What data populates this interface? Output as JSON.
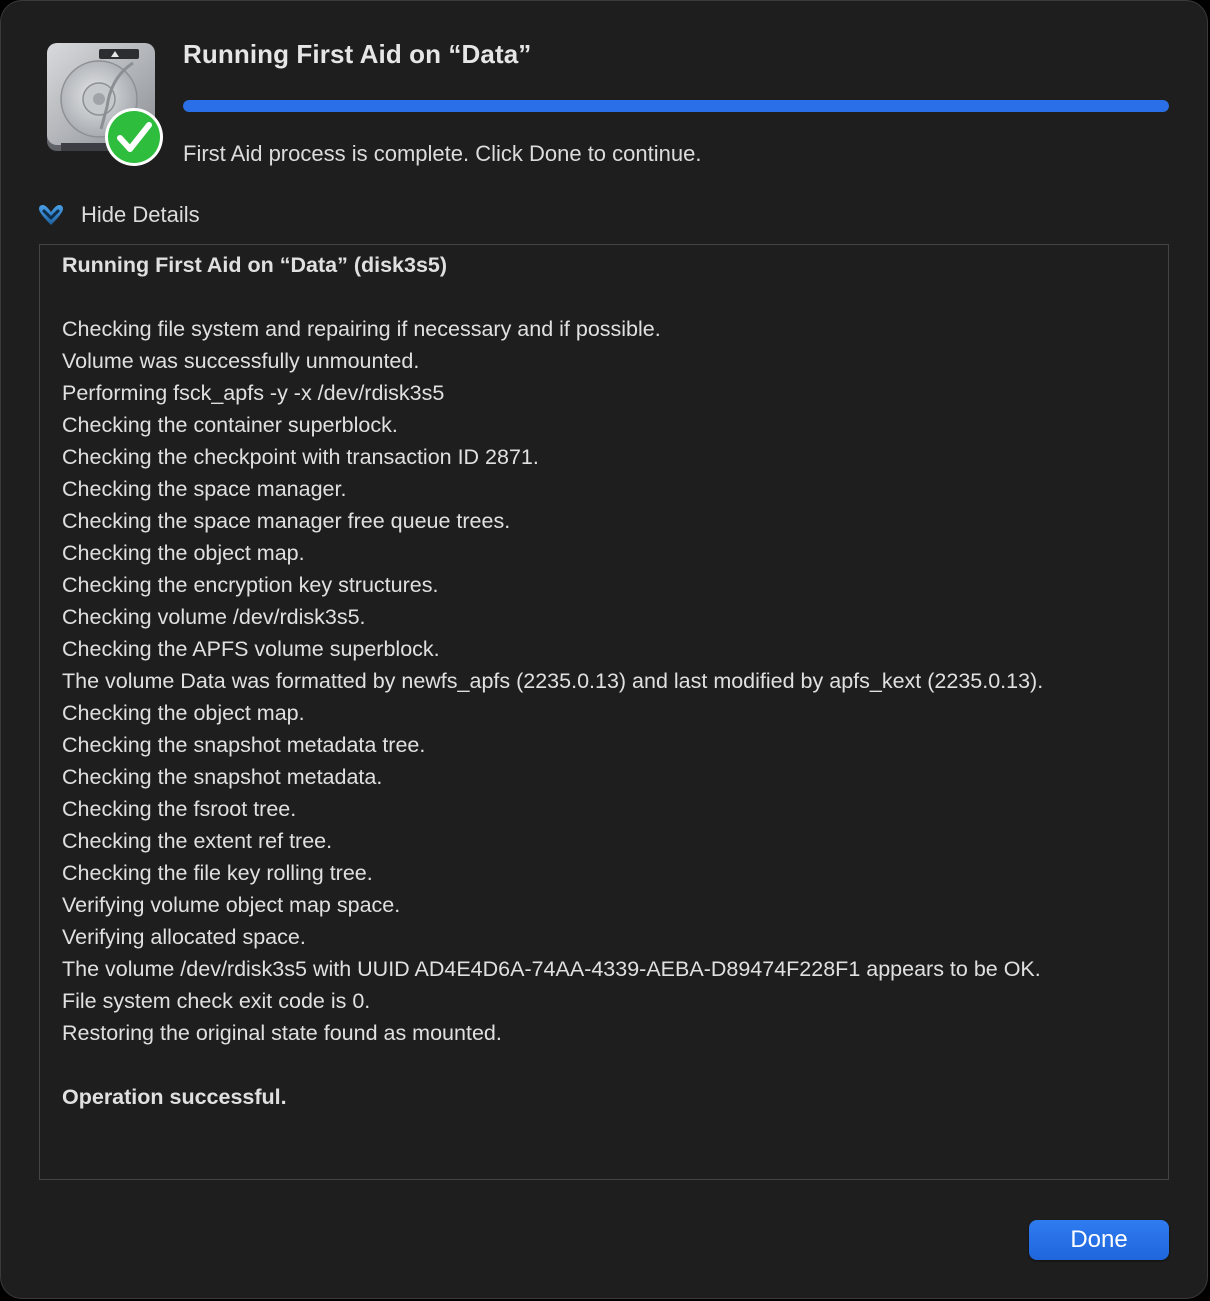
{
  "dialog": {
    "title": "Running First Aid on “Data”",
    "progress": 1.0,
    "status": "First Aid process is complete. Click Done to continue.",
    "details_toggle_label": "Hide Details",
    "done_label": "Done"
  },
  "log": {
    "lines": [
      {
        "text": "Running First Aid on “Data” (disk3s5)",
        "bold": true
      },
      {
        "text": "",
        "bold": false
      },
      {
        "text": "Checking file system and repairing if necessary and if possible.",
        "bold": false
      },
      {
        "text": "Volume was successfully unmounted.",
        "bold": false
      },
      {
        "text": "Performing fsck_apfs -y -x /dev/rdisk3s5",
        "bold": false
      },
      {
        "text": "Checking the container superblock.",
        "bold": false
      },
      {
        "text": "Checking the checkpoint with transaction ID 2871.",
        "bold": false
      },
      {
        "text": "Checking the space manager.",
        "bold": false
      },
      {
        "text": "Checking the space manager free queue trees.",
        "bold": false
      },
      {
        "text": "Checking the object map.",
        "bold": false
      },
      {
        "text": "Checking the encryption key structures.",
        "bold": false
      },
      {
        "text": "Checking volume /dev/rdisk3s5.",
        "bold": false
      },
      {
        "text": "Checking the APFS volume superblock.",
        "bold": false
      },
      {
        "text": "The volume Data was formatted by newfs_apfs (2235.0.13) and last modified by apfs_kext (2235.0.13).",
        "bold": false
      },
      {
        "text": "Checking the object map.",
        "bold": false
      },
      {
        "text": "Checking the snapshot metadata tree.",
        "bold": false
      },
      {
        "text": "Checking the snapshot metadata.",
        "bold": false
      },
      {
        "text": "Checking the fsroot tree.",
        "bold": false
      },
      {
        "text": "Checking the extent ref tree.",
        "bold": false
      },
      {
        "text": "Checking the file key rolling tree.",
        "bold": false
      },
      {
        "text": "Verifying volume object map space.",
        "bold": false
      },
      {
        "text": "Verifying allocated space.",
        "bold": false
      },
      {
        "text": "The volume /dev/rdisk3s5 with UUID AD4E4D6A-74AA-4339-AEBA-D89474F228F1 appears to be OK.",
        "bold": false
      },
      {
        "text": "File system check exit code is 0.",
        "bold": false
      },
      {
        "text": "Restoring the original state found as mounted.",
        "bold": false
      },
      {
        "text": "",
        "bold": false
      },
      {
        "text": "Operation successful.",
        "bold": true
      }
    ]
  },
  "icons": {
    "disk": "hard-disk-icon",
    "check": "checkmark-badge-icon",
    "toggle": "chevron-down-icon"
  },
  "colors": {
    "background": "#1e1e1e",
    "accent": "#2a6ee8",
    "success": "#2ebd3c",
    "text": "#e0e0e0"
  }
}
